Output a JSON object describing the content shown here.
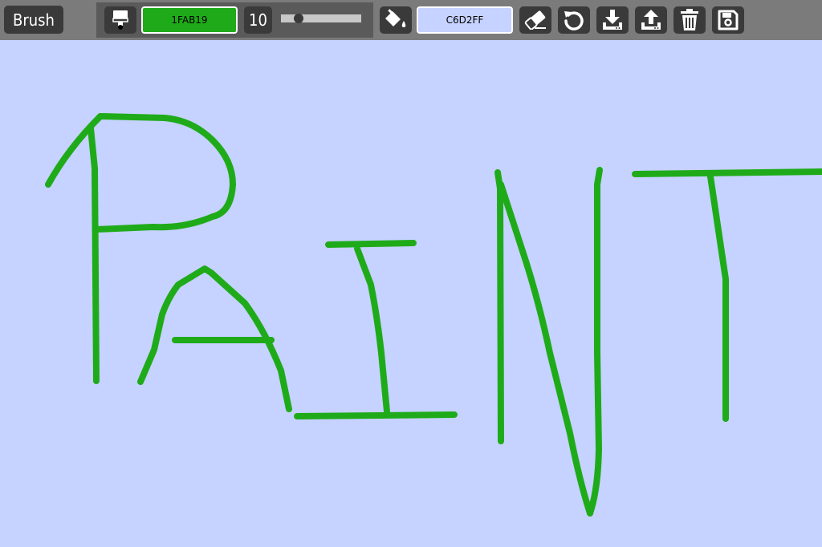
{
  "toolbar": {
    "mode_label": "Brush",
    "brush_color_hex": "1FAB19",
    "brush_size": "10",
    "brush_size_slider_fraction": 0.22,
    "background_color_hex": "C6D2FF",
    "icons": {
      "brush": "paintbrush-icon",
      "fill": "paint-bucket-icon",
      "erase": "eraser-icon",
      "undo": "undo-icon",
      "download": "download-icon",
      "upload": "upload-icon",
      "clear": "trash-icon",
      "save": "save-icon"
    }
  },
  "colors": {
    "toolbar_bg": "#7b7b7b",
    "button_bg": "#3a3a3a",
    "brush_color": "#1FAB19",
    "canvas_bg": "#C6D2FF"
  }
}
